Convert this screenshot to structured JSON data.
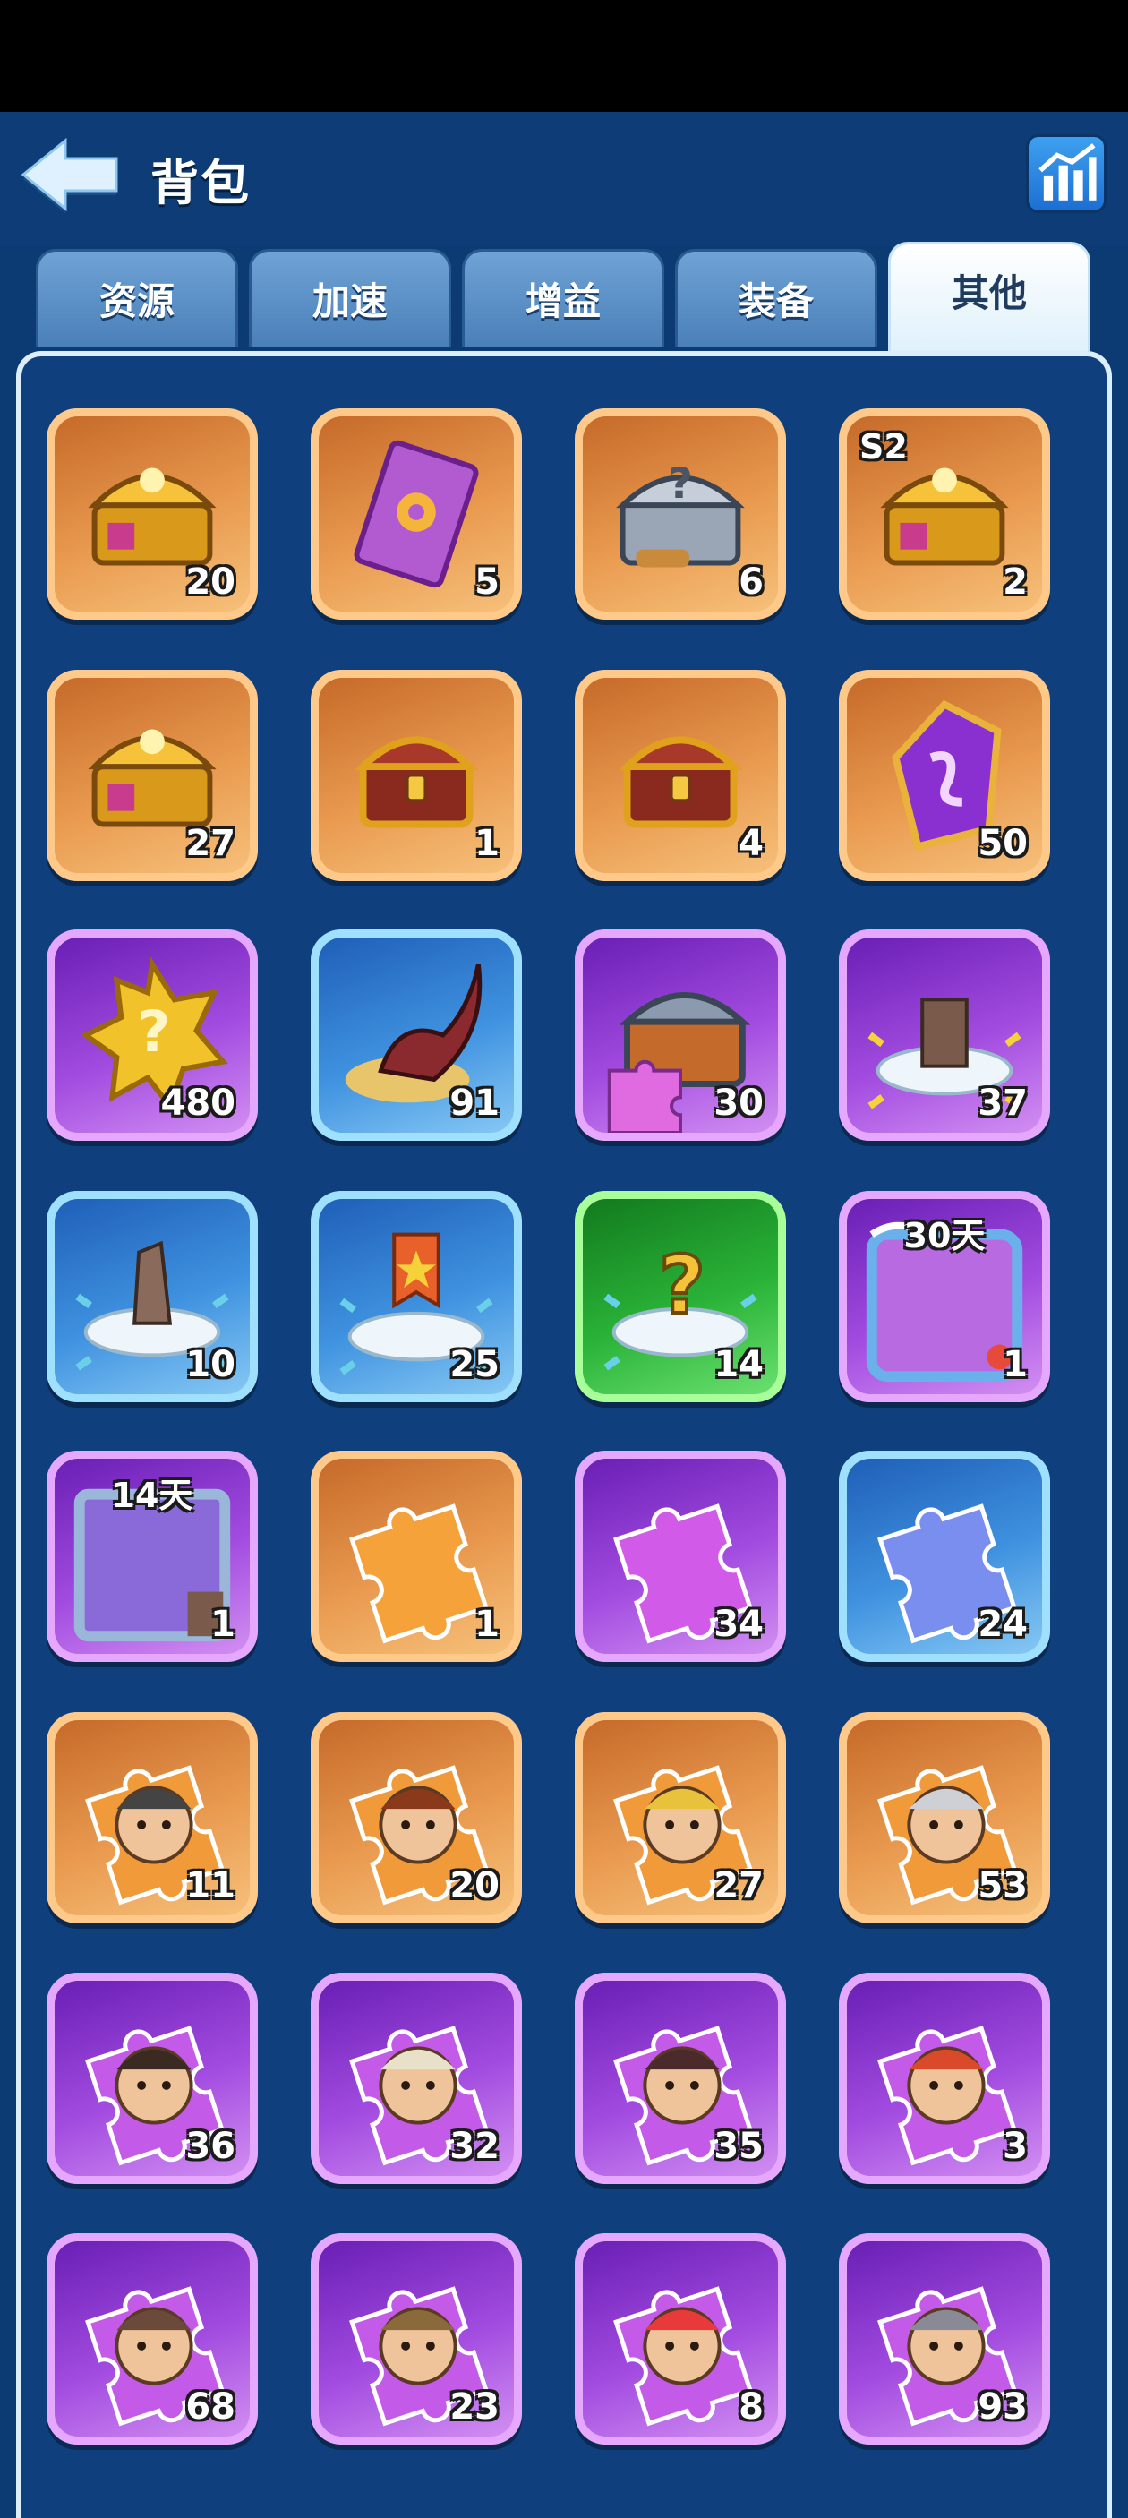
{
  "header": {
    "title": "背包",
    "back_icon": "back-arrow-icon",
    "stats_icon": "bar-chart-icon"
  },
  "tabs": [
    {
      "label": "资源",
      "active": false
    },
    {
      "label": "加速",
      "active": false
    },
    {
      "label": "增益",
      "active": false
    },
    {
      "label": "装备",
      "active": false
    },
    {
      "label": "其他",
      "active": true
    }
  ],
  "items": [
    {
      "icon": "gold-treasure-chest-icon",
      "rarity": "orange",
      "count": "20"
    },
    {
      "icon": "purple-card-icon",
      "rarity": "orange",
      "count": "5"
    },
    {
      "icon": "silver-mystery-chest-icon",
      "rarity": "orange",
      "count": "6"
    },
    {
      "icon": "s2-treasure-chest-icon",
      "rarity": "orange",
      "count": "2",
      "badge": "S2"
    },
    {
      "icon": "open-gold-chest-icon",
      "rarity": "orange",
      "count": "27"
    },
    {
      "icon": "red-gold-chest-with-gear-icon",
      "rarity": "orange",
      "count": "1"
    },
    {
      "icon": "red-gold-chest-icon",
      "rarity": "orange",
      "count": "4"
    },
    {
      "icon": "purple-rune-stone-icon",
      "rarity": "orange",
      "count": "50"
    },
    {
      "icon": "gold-mystery-badge-icon",
      "rarity": "purple",
      "count": "480"
    },
    {
      "icon": "horn-in-nest-icon",
      "rarity": "blue",
      "count": "91"
    },
    {
      "icon": "puzzle-chest-icon",
      "rarity": "purple",
      "count": "30"
    },
    {
      "icon": "tower-decoration-icon",
      "rarity": "purple",
      "count": "37"
    },
    {
      "icon": "statue-decoration-icon",
      "rarity": "blue",
      "count": "10"
    },
    {
      "icon": "banner-decoration-icon",
      "rarity": "blue",
      "count": "25"
    },
    {
      "icon": "mystery-decoration-icon",
      "rarity": "green",
      "count": "14"
    },
    {
      "icon": "ocean-avatar-frame-icon",
      "rarity": "purple",
      "count": "1",
      "days": "30天"
    },
    {
      "icon": "ice-avatar-frame-icon",
      "rarity": "purple",
      "count": "1",
      "days": "14天"
    },
    {
      "icon": "orange-puzzle-piece-icon",
      "rarity": "orange",
      "count": "1"
    },
    {
      "icon": "purple-puzzle-piece-icon",
      "rarity": "purple",
      "count": "34"
    },
    {
      "icon": "blue-puzzle-piece-icon",
      "rarity": "blue",
      "count": "24"
    },
    {
      "icon": "hero-fragment-helmet-icon",
      "rarity": "orange",
      "count": "11"
    },
    {
      "icon": "hero-fragment-redhair-icon",
      "rarity": "orange",
      "count": "20"
    },
    {
      "icon": "hero-fragment-miner-icon",
      "rarity": "orange",
      "count": "27"
    },
    {
      "icon": "hero-fragment-goggles-girl-icon",
      "rarity": "orange",
      "count": "53"
    },
    {
      "icon": "hero-fragment-doctor-icon",
      "rarity": "purple",
      "count": "36"
    },
    {
      "icon": "hero-fragment-desert-icon",
      "rarity": "purple",
      "count": "32"
    },
    {
      "icon": "hero-fragment-girl-icon",
      "rarity": "purple",
      "count": "35"
    },
    {
      "icon": "hero-fragment-redhead-girl-icon",
      "rarity": "purple",
      "count": "3"
    },
    {
      "icon": "hero-fragment-viking-icon",
      "rarity": "purple",
      "count": "68"
    },
    {
      "icon": "hero-fragment-pilot-icon",
      "rarity": "purple",
      "count": "23"
    },
    {
      "icon": "hero-fragment-santa-icon",
      "rarity": "purple",
      "count": "8"
    },
    {
      "icon": "hero-fragment-beard-helmet-icon",
      "rarity": "purple",
      "count": "93"
    }
  ]
}
